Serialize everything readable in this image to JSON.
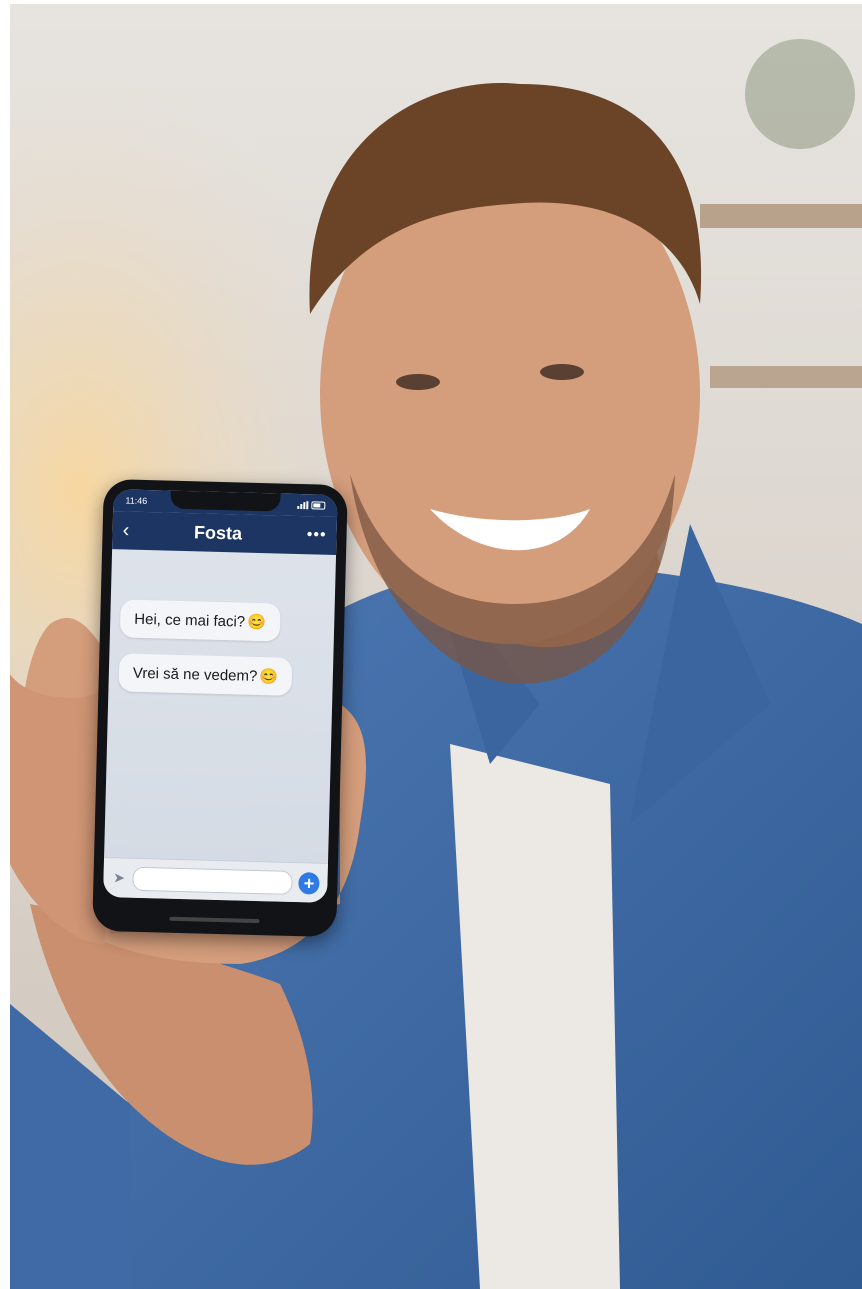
{
  "status": {
    "time": "11:46"
  },
  "chat": {
    "contact_name": "Fosta",
    "back_icon": "chevron-left-icon",
    "more_icon": "more-horizontal-icon",
    "messages": [
      {
        "text": "Hei, ce mai faci?",
        "emoji": "😊"
      },
      {
        "text": "Vrei să ne vedem?",
        "emoji": "😊"
      }
    ]
  },
  "composer": {
    "input_value": "",
    "send_icon": "plus-icon",
    "attach_icon": "attach-icon"
  },
  "colors": {
    "header": "#1c3563",
    "send": "#2f7be6",
    "shirt": "#3f6aa6"
  }
}
